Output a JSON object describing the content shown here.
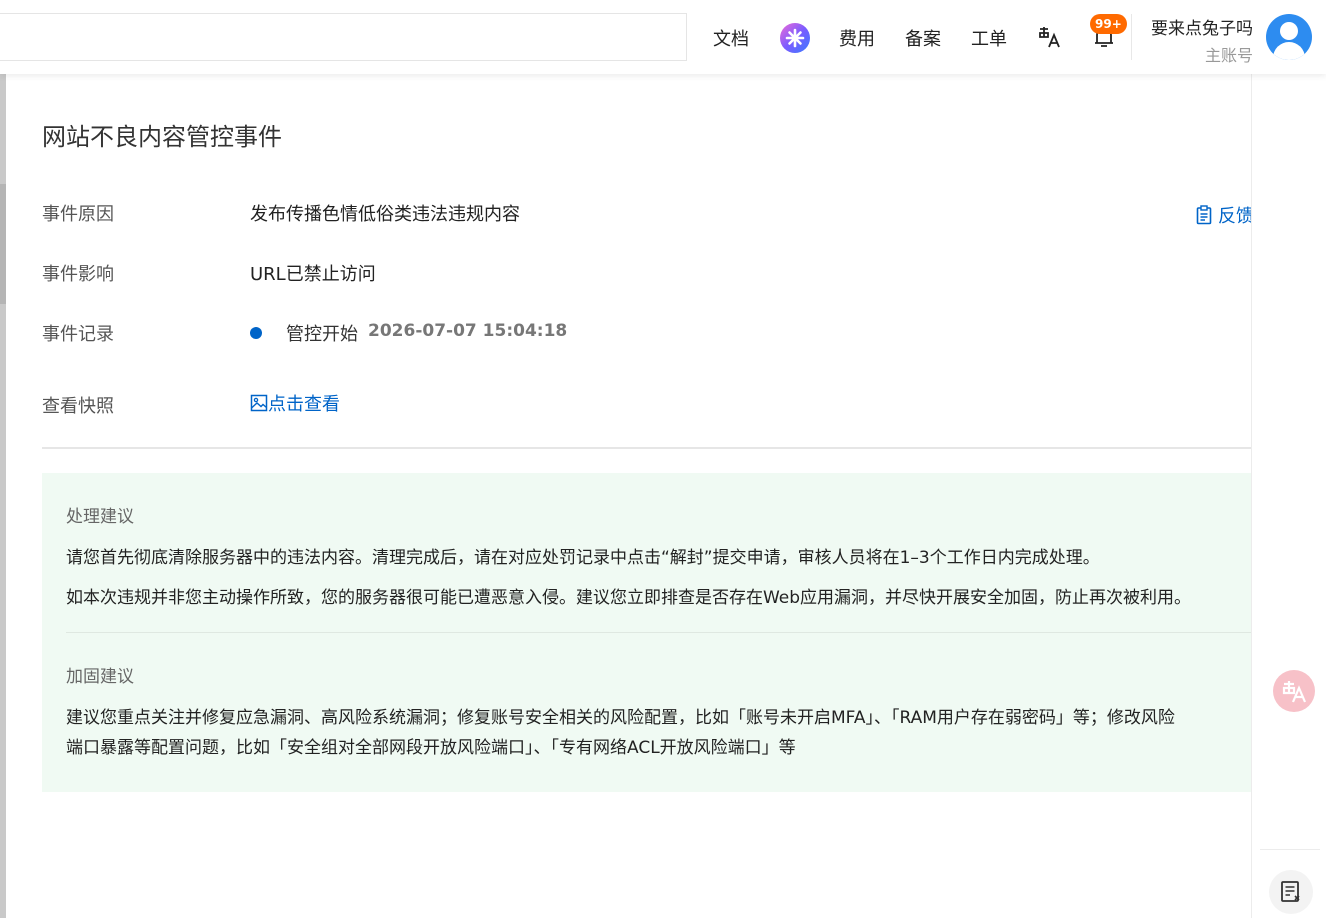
{
  "header": {
    "nav": [
      "文档",
      "费用",
      "备案",
      "工单"
    ],
    "notification_badge": "99+",
    "user_name": "要来点兔子吗",
    "user_role": "主账号",
    "brand_color": "#0064c8",
    "badge_color": "#ff6a00"
  },
  "event": {
    "title": "网站不良内容管控事件",
    "feedback_label": "反馈",
    "rows": {
      "reason_label": "事件原因",
      "reason_value": "发布传播色情低俗类违法违规内容",
      "impact_label": "事件影响",
      "impact_value": "URL已禁止访问",
      "record_label": "事件记录",
      "record_event": "管控开始",
      "record_time": "2026-07-07 15:04:18",
      "snapshot_label": "查看快照",
      "snapshot_link": "点击查看"
    }
  },
  "advice": {
    "handling_title": "处理建议",
    "handling_p1": "请您首先彻底清除服务器中的违法内容。清理完成后，请在对应处罚记录中点击“解封”提交申请，审核人员将在1–3个工作日内完成处理。",
    "handling_p2": "如本次违规并非您主动操作所致，您的服务器很可能已遭恶意入侵。建议您立即排查是否存在Web应用漏洞，并尽快开展安全加固，防止再次被利用。",
    "hardening_title": "加固建议",
    "hardening_p1": "建议您重点关注并修复应急漏洞、高风险系统漏洞；修复账号安全相关的风险配置，比如「账号未开启MFA」、「RAM用户存在弱密码」等；修改风险",
    "hardening_p2": "端口暴露等配置问题，比如「安全组对全部网段开放风险端口」、「专有网络ACL开放风险端口」等",
    "background_color": "#f0faf3"
  }
}
